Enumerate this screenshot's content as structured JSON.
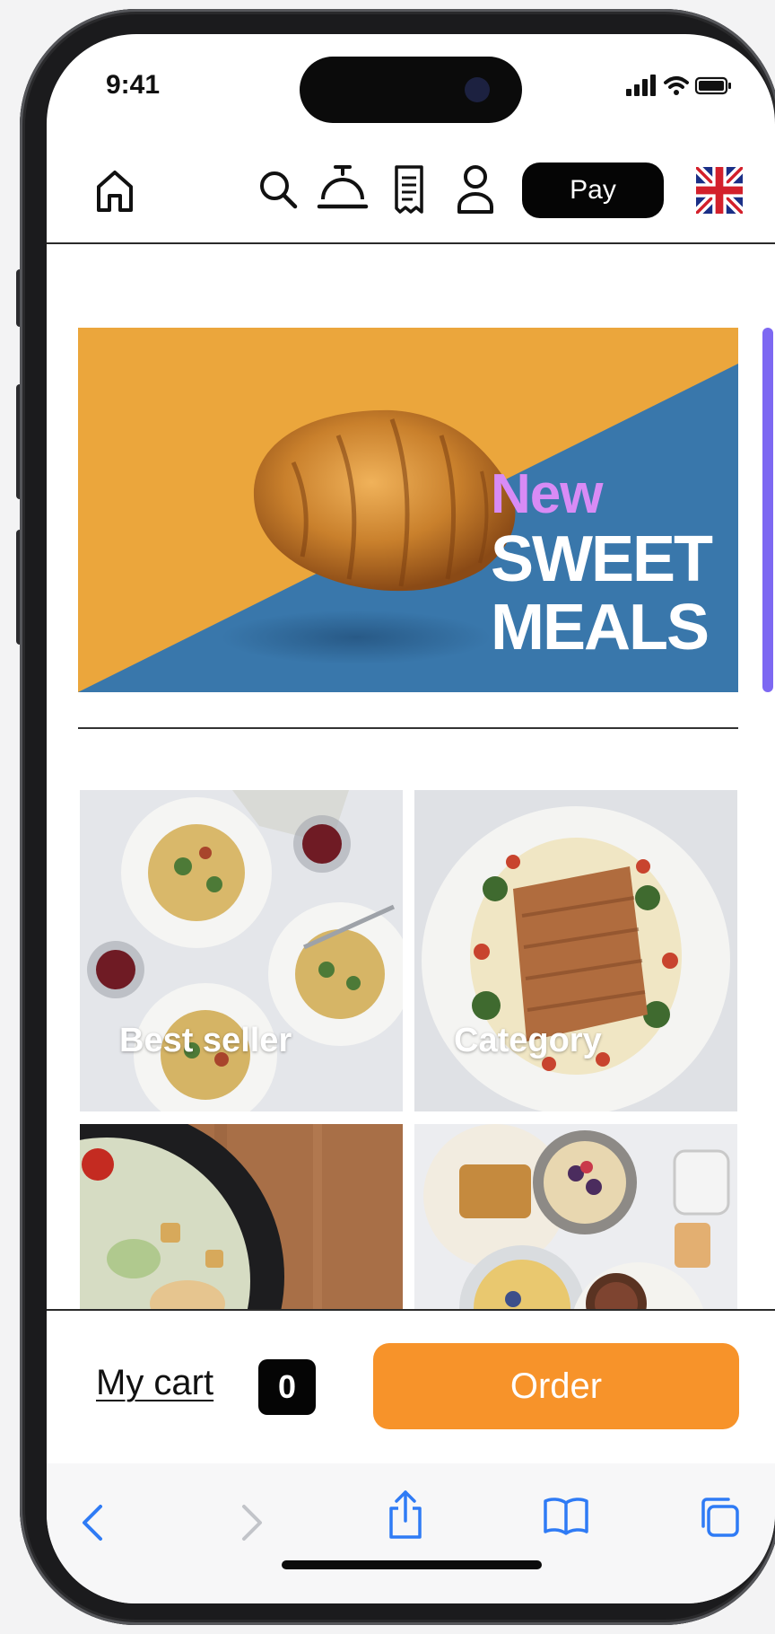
{
  "status_bar": {
    "time": "9:41"
  },
  "header": {
    "pay_label": "Pay"
  },
  "banner": {
    "badge": "New",
    "line1": "SWEET",
    "line2": "MEALS"
  },
  "tiles": [
    {
      "label": "Best seller"
    },
    {
      "label": "Category"
    },
    {
      "label": ""
    },
    {
      "label": ""
    }
  ],
  "footer": {
    "cart_label": "My cart",
    "cart_count": "0",
    "order_label": "Order"
  },
  "colors": {
    "accent": "#f7932a",
    "banner_orange": "#eba63c",
    "banner_blue": "#3977ab",
    "badge": "#d88bf5"
  },
  "icons": [
    "home-icon",
    "search-icon",
    "service-bell-icon",
    "receipt-icon",
    "user-icon",
    "uk-flag-icon",
    "back-icon",
    "forward-icon",
    "share-icon",
    "bookmarks-icon",
    "tabs-icon"
  ]
}
